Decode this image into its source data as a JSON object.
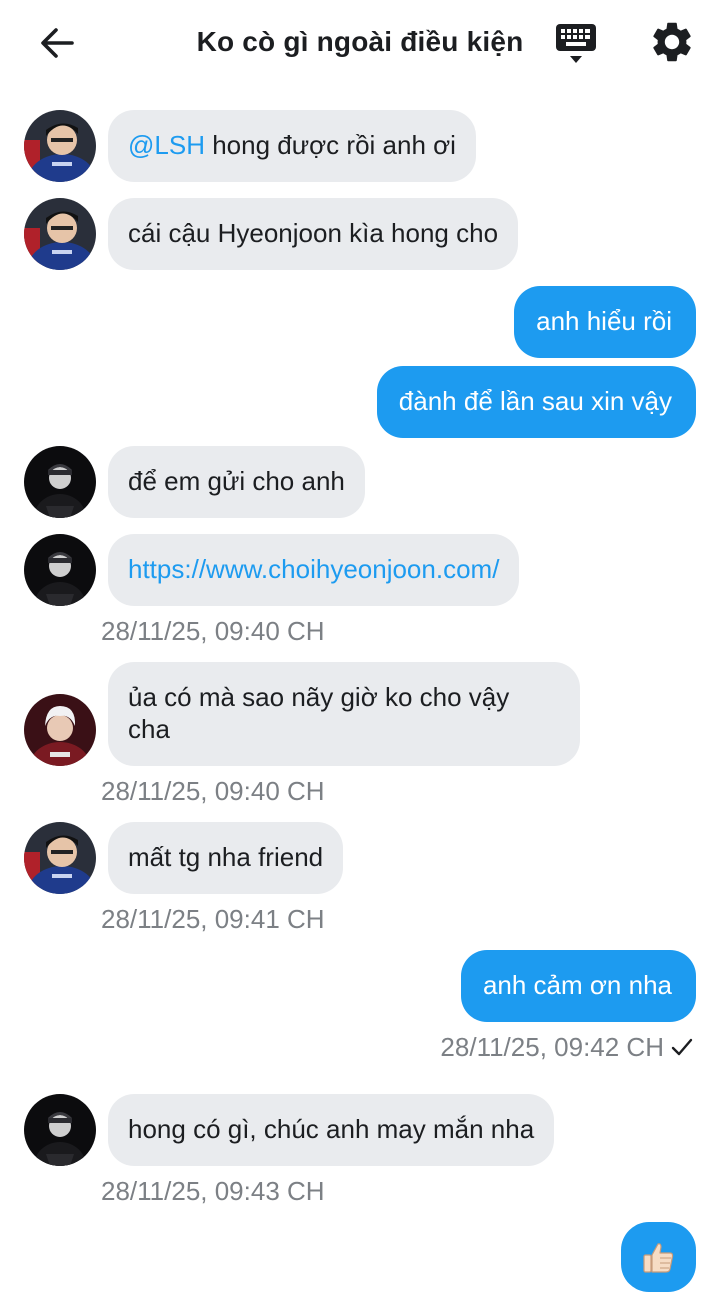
{
  "header": {
    "title": "Ko cò gì ngoài điều kiện",
    "icons": [
      "back-arrow-icon",
      "keyboard-icon",
      "gear-icon"
    ]
  },
  "messages": [
    {
      "side": "in",
      "avatar": "lsh",
      "mention": "@LSH",
      "text": " hong được rồi anh ơi"
    },
    {
      "side": "in",
      "avatar": "lsh",
      "text": "cái cậu Hyeonjoon kìa hong cho"
    },
    {
      "side": "out",
      "text": "anh hiểu rồi"
    },
    {
      "side": "out",
      "text": "đành để lần sau xin vậy"
    },
    {
      "side": "in",
      "avatar": "hj",
      "text": "để em gửi cho anh"
    },
    {
      "side": "in",
      "avatar": "hj",
      "link": "https://www.choihyeonjoon.com/",
      "time": "28/11/25, 09:40 CH"
    },
    {
      "side": "in",
      "avatar": "red",
      "line1": "ủa có mà sao nãy giờ ko cho vậy",
      "line2": "cha",
      "time": "28/11/25, 09:40 CH"
    },
    {
      "side": "in",
      "avatar": "lsh",
      "text": "mất tg nha friend",
      "time": "28/11/25, 09:41 CH"
    },
    {
      "side": "out",
      "text": "anh cảm ơn nha",
      "time": "28/11/25, 09:42 CH",
      "status": "✓"
    },
    {
      "side": "in",
      "avatar": "hj",
      "text": "hong có gì, chúc anh may mắn nha",
      "time": "28/11/25, 09:43 CH"
    },
    {
      "side": "out",
      "emoji": "thumbs-up"
    }
  ],
  "colors": {
    "accent": "#1d9bf0",
    "incoming_bubble": "#e9ebee",
    "timestamp": "#7c8085"
  }
}
